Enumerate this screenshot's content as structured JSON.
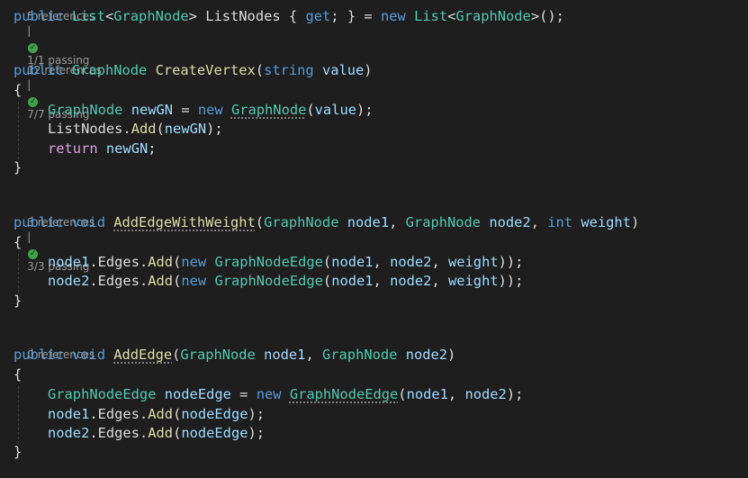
{
  "colors": {
    "background": "#1e1e1e",
    "keyword": "#569cd6",
    "control_keyword": "#d8a0df",
    "type": "#4ec9b0",
    "method": "#dcdcaa",
    "identifier": "#dcdcdc",
    "parameter": "#9cdcfe",
    "codelens": "#999999",
    "passing_check": "#3fa34d"
  },
  "lens": {
    "l1_refs": "5 references",
    "l1_pass": "1/1 passing",
    "l2_refs": "12 references",
    "l2_pass": "7/7 passing",
    "l3_refs": "3 references",
    "l3_pass": "3/3 passing",
    "l4_refs": "0 references",
    "sep": "|",
    "pass_icon": "check-circle-icon"
  },
  "code": {
    "t": {
      "public": "public",
      "void": "void",
      "string": "string",
      "int": "int",
      "new": "new",
      "get": "get",
      "return": "return",
      "List": "List",
      "GraphNode": "GraphNode",
      "GraphNodeEdge": "GraphNodeEdge",
      "ListNodes": "ListNodes",
      "CreateVertex": "CreateVertex",
      "AddEdgeWithWeight": "AddEdgeWithWeight",
      "AddEdge": "AddEdge",
      "Add": "Add",
      "Edges": "Edges",
      "value": "value",
      "newGN": "newGN",
      "node1": "node1",
      "node2": "node2",
      "weight": "weight",
      "nodeEdge": "nodeEdge",
      "lt": "<",
      "gt": ">",
      "sp": " ",
      "lbrace": "{",
      "rbrace": "}",
      "lparen": "(",
      "rparen": ")",
      "semi": ";",
      "dot": ".",
      "comma": ",",
      "eq": "=",
      "call_end": "();"
    }
  }
}
